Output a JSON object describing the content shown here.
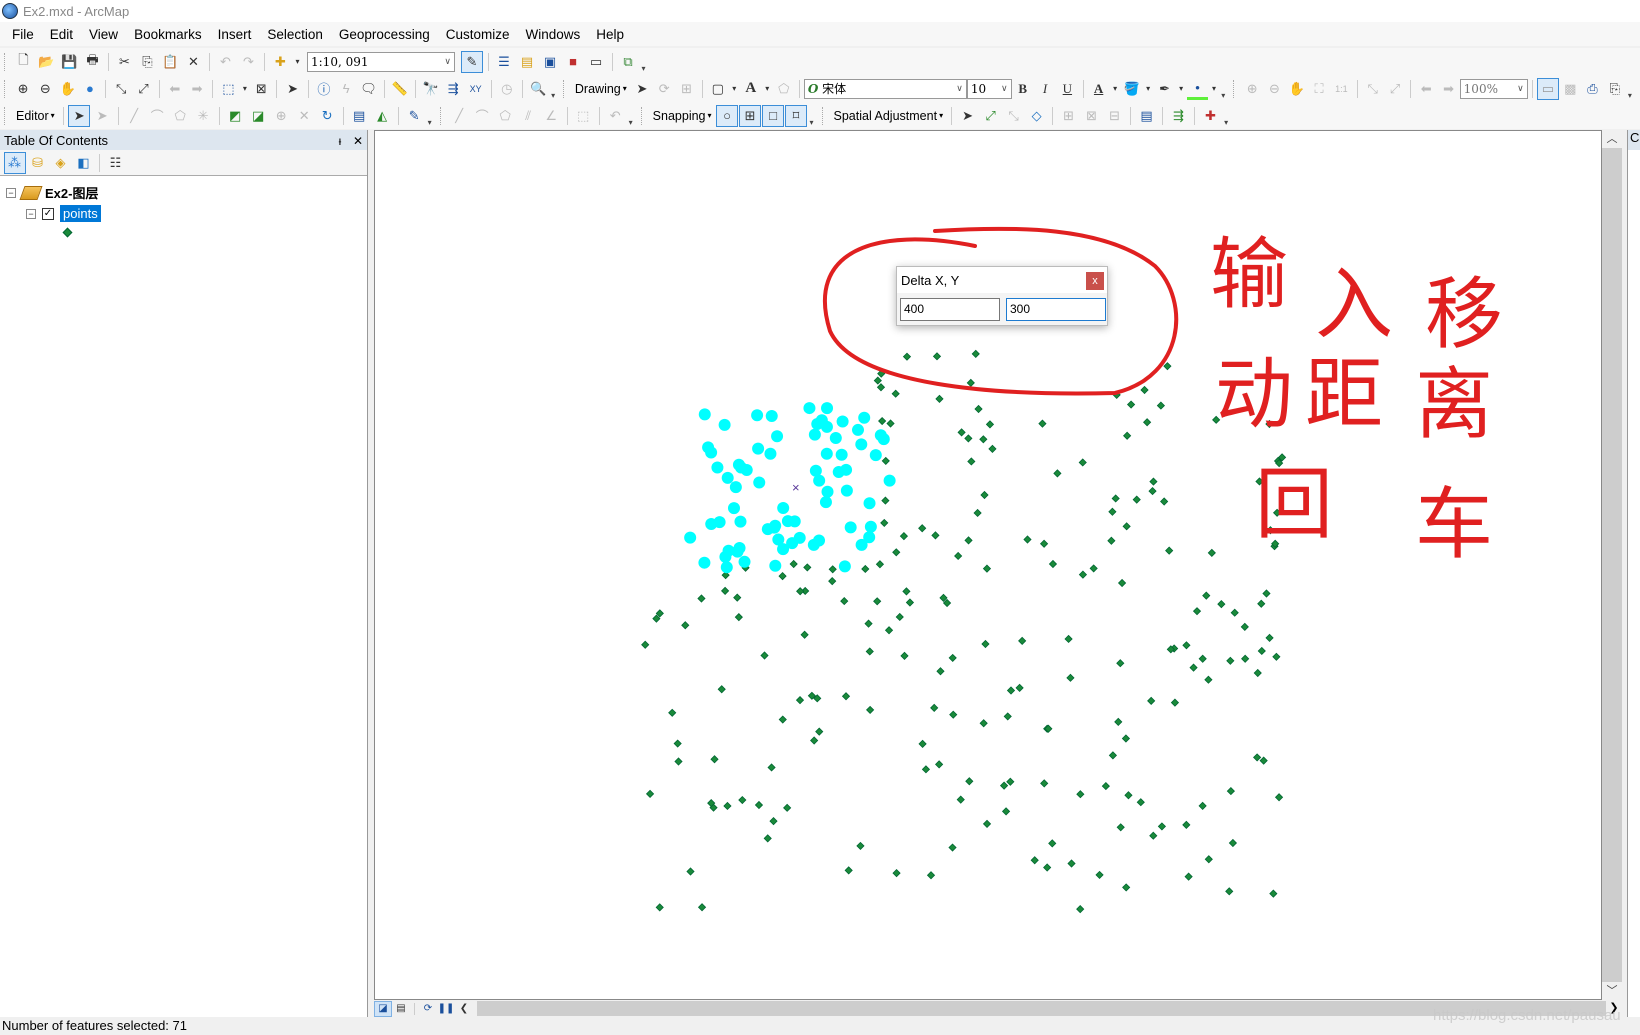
{
  "window": {
    "title": "Ex2.mxd - ArcMap"
  },
  "menu": [
    "File",
    "Edit",
    "View",
    "Bookmarks",
    "Insert",
    "Selection",
    "Geoprocessing",
    "Customize",
    "Windows",
    "Help"
  ],
  "standard_toolbar": {
    "scale": "1:10, 091"
  },
  "drawing_toolbar": {
    "drawing_label": "Drawing",
    "font_name": "宋体",
    "font_size": "10",
    "bold": "B",
    "italic": "I",
    "underline": "U",
    "zoom_percent": "100%"
  },
  "editor_toolbar": {
    "editor_label": "Editor",
    "snapping_label": "Snapping",
    "spatial_adjustment_label": "Spatial Adjustment"
  },
  "toc": {
    "title": "Table Of Contents",
    "pin": "ᵼ",
    "close": "✕",
    "layers": [
      {
        "name": "Ex2-图层",
        "children": [
          {
            "name": "points",
            "checked": true,
            "selected": true
          }
        ]
      }
    ]
  },
  "dialog": {
    "title": "Delta X, Y",
    "close": "x",
    "delta_x": "400",
    "delta_y": "300"
  },
  "annotation": {
    "text": "输入移动距离 回车",
    "color": "#e02020"
  },
  "status": {
    "text": "Number of features selected: 71"
  },
  "watermark": "https://blog.csdn.net/pausau",
  "right_panel": {
    "title": "Cr"
  },
  "colors": {
    "selected_points": "#00ffff",
    "points": "#1a8a3a",
    "selection_highlight": "#0078d7"
  }
}
